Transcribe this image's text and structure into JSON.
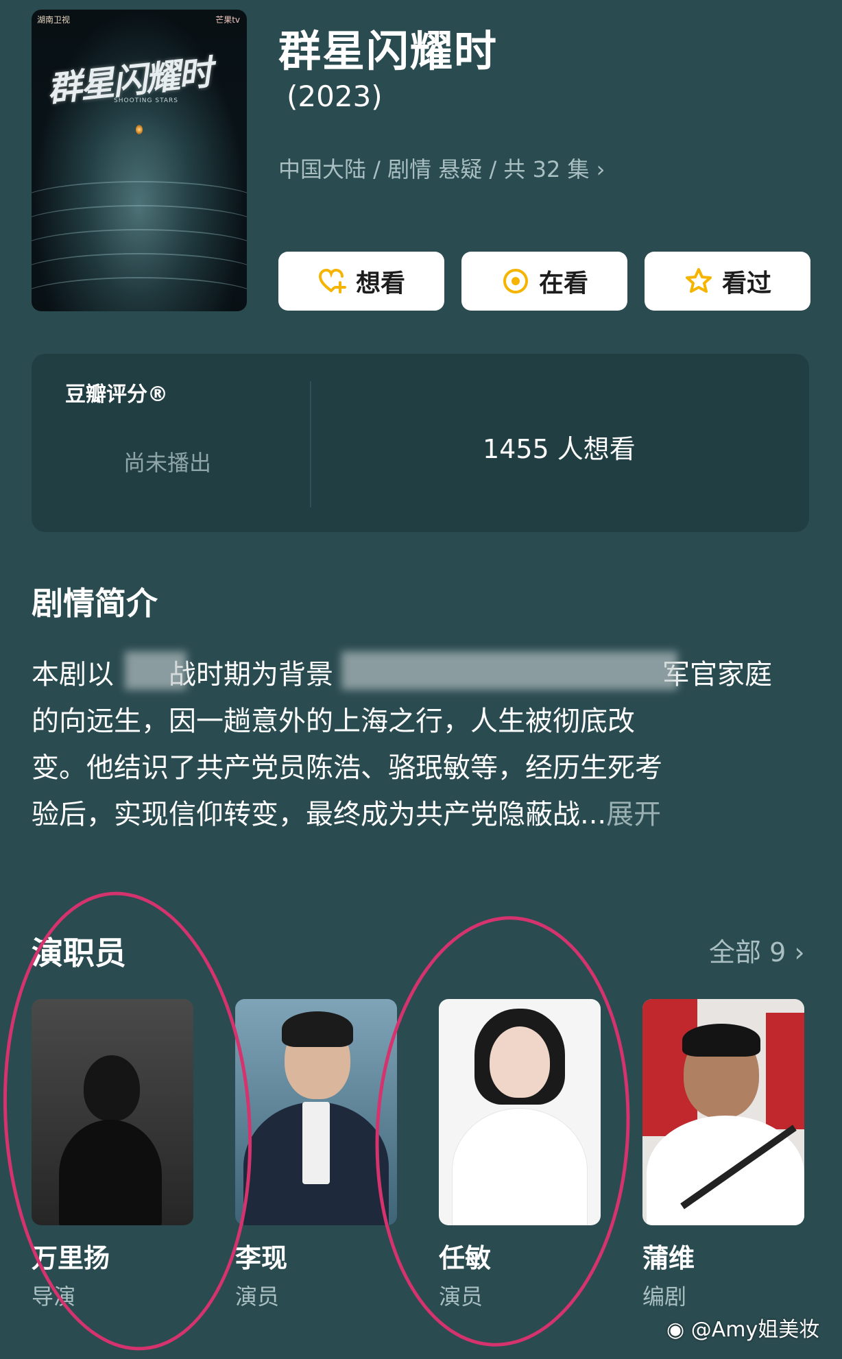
{
  "poster": {
    "title_art": "群星闪耀时",
    "subtitle_art": "SHOOTING STARS",
    "logo_left": "湖南卫视",
    "logo_right": "芒果tv"
  },
  "show": {
    "title": "群星闪耀时",
    "year": "(2023)",
    "meta": "中国大陆 / 剧情 悬疑 / 共 32 集",
    "meta_chevron": "›"
  },
  "actions": [
    {
      "label": "想看",
      "icon": "heart-plus-icon"
    },
    {
      "label": "在看",
      "icon": "target-icon"
    },
    {
      "label": "看过",
      "icon": "star-icon"
    }
  ],
  "rating": {
    "label": "豆瓣评分®",
    "status": "尚未播出",
    "want_count": "1455 人想看"
  },
  "synopsis": {
    "heading": "剧情简介",
    "lines": [
      "本剧以　　战时期为背景　　　　　　　　　　　　军官家庭",
      "的向远生，因一趟意外的上海之行，人生被彻底改",
      "变。他结识了共产党员陈浩、骆珉敏等，经历生死考",
      "验后，实现信仰转变，最终成为共产党隐蔽战..."
    ],
    "expand": "展开"
  },
  "cast": {
    "heading": "演职员",
    "all_label": "全部 9 ›",
    "members": [
      {
        "name": "万里扬",
        "role": "导演"
      },
      {
        "name": "李现",
        "role": "演员"
      },
      {
        "name": "任敏",
        "role": "演员"
      },
      {
        "name": "蒲维",
        "role": "编剧"
      }
    ]
  },
  "watermark": "@Amy姐美妆",
  "colors": {
    "background": "#2a4b50",
    "card": "#213e43",
    "accent": "#f5b400",
    "annotation": "#d4336e"
  }
}
